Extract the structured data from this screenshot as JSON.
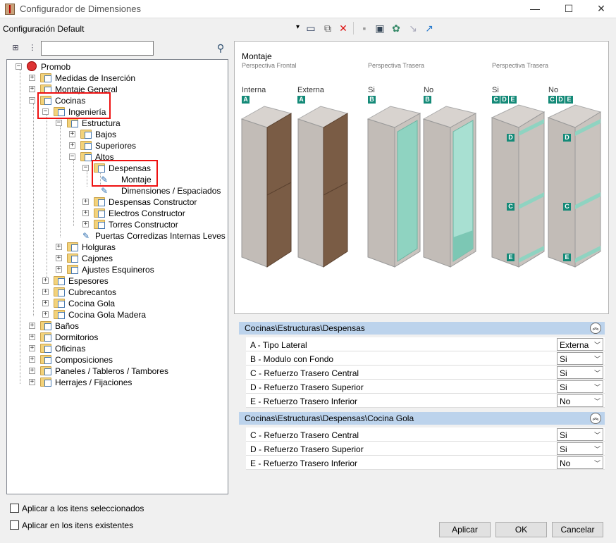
{
  "window": {
    "title": "Configurador de Dimensiones",
    "minimize": "—",
    "maximize": "☐",
    "close": "✕"
  },
  "toolbar": {
    "config_value": "Configuración Default"
  },
  "tree": {
    "nodes": [
      {
        "label": "Promob"
      },
      {
        "label": "Medidas de Inserción"
      },
      {
        "label": "Montaje General"
      },
      {
        "label": "Cocinas"
      },
      {
        "label": "Ingeniería"
      },
      {
        "label": "Estructura"
      },
      {
        "label": "Bajos"
      },
      {
        "label": "Superiores"
      },
      {
        "label": "Altos"
      },
      {
        "label": "Despensas"
      },
      {
        "label": "Montaje"
      },
      {
        "label": "Dimensiones / Espaciados"
      },
      {
        "label": "Despensas Constructor"
      },
      {
        "label": "Electros Constructor"
      },
      {
        "label": "Torres Constructor"
      },
      {
        "label": "Puertas Corredizas Internas Leves"
      },
      {
        "label": "Holguras"
      },
      {
        "label": "Cajones"
      },
      {
        "label": "Ajustes Esquineros"
      },
      {
        "label": "Espesores"
      },
      {
        "label": "Cubrecantos"
      },
      {
        "label": "Cocina Gola"
      },
      {
        "label": "Cocina Gola Madera"
      },
      {
        "label": "Baños"
      },
      {
        "label": "Dormitorios"
      },
      {
        "label": "Oficinas"
      },
      {
        "label": "Composiciones"
      },
      {
        "label": "Paneles / Tableros / Tambores"
      },
      {
        "label": "Herrajes / Fijaciones"
      }
    ]
  },
  "preview": {
    "title": "Montaje",
    "groups": [
      {
        "caption": "Perspectiva Frontal"
      },
      {
        "caption": "Perspectiva Trasera"
      },
      {
        "caption": "Perspectiva Trasera"
      }
    ],
    "labels": [
      "Interna",
      "Externa",
      "Si",
      "No",
      "Si",
      "No"
    ],
    "badges": {
      "a": "A",
      "b": "B",
      "c": "C",
      "d": "D",
      "e": "E"
    }
  },
  "props": {
    "section1": {
      "title": "Cocinas\\Estructuras\\Despensas",
      "rows": [
        {
          "label": "A - Tipo Lateral",
          "value": "Externa"
        },
        {
          "label": "B - Modulo con Fondo",
          "value": "Si"
        },
        {
          "label": "C - Refuerzo Trasero Central",
          "value": "Si"
        },
        {
          "label": "D - Refuerzo Trasero Superior",
          "value": "Si"
        },
        {
          "label": "E - Refuerzo Trasero Inferior",
          "value": "No"
        }
      ]
    },
    "section2": {
      "title": "Cocinas\\Estructuras\\Despensas\\Cocina Gola",
      "rows": [
        {
          "label": "C - Refuerzo Trasero Central",
          "value": "Si"
        },
        {
          "label": "D - Refuerzo Trasero Superior",
          "value": "Si"
        },
        {
          "label": "E - Refuerzo Trasero Inferior",
          "value": "No"
        }
      ]
    }
  },
  "footer": {
    "apply_selected": "Aplicar a los itens seleccionados",
    "apply_existing": "Aplicar en los itens existentes",
    "apply_btn": "Aplicar",
    "ok_btn": "OK",
    "cancel_btn": "Cancelar"
  },
  "colors": {
    "accent_teal": "#148a78",
    "highlight_red": "#e11111",
    "section_blue": "#bcd3ec"
  }
}
